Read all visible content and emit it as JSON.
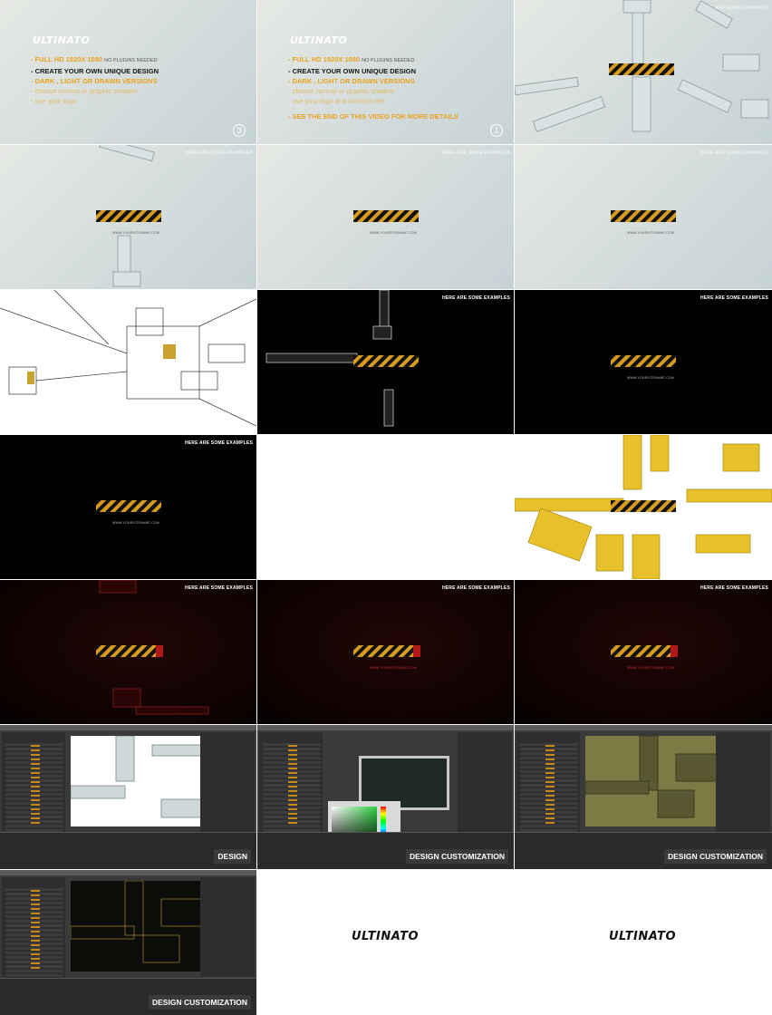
{
  "brand": "ULTINATO",
  "examples_label": "HERE ARE SOME EXAMPLES",
  "url_text": "WWW.YOURSITENAME.COM",
  "feature_list_a": {
    "line1_main": "- FULL HD 1920X 1080",
    "line1_sub": "NO PLUGINS NEEDED",
    "line2": "- CREATE YOUR OWN UNIQUE DESIGN",
    "line3": "- DARK , LIGHT OR DRAWN VERSIONS",
    "line4": "- choose normal or graphic shadow",
    "line5": "- use your logo",
    "badge": "3"
  },
  "feature_list_b": {
    "line1_main": "- FULL HD 1920X 1080",
    "line1_sub": "NO PLUGINS NEEDED",
    "line2": "- CREATE YOUR OWN UNIQUE DESIGN",
    "line3": "- DARK , LIGHT OR DRAWN VERSIONS",
    "line4": "- choose normal or graphic shadow",
    "line5": "- use your logo and mention title",
    "see_end": "- SEE THE END OF THIS VIDEO FOR MORE DETAILS",
    "badge": "1"
  },
  "captions": {
    "design": "DESIGN",
    "customization": "DESIGN CUSTOMIZATION"
  },
  "colors": {
    "accent_orange": "#e8a323",
    "stripe_dark": "#111111",
    "robot_yellow": "#e8c12a",
    "robot_grey": "#c8d2d2",
    "red_accent": "#b21818",
    "picker_green": "#2ecc40"
  }
}
